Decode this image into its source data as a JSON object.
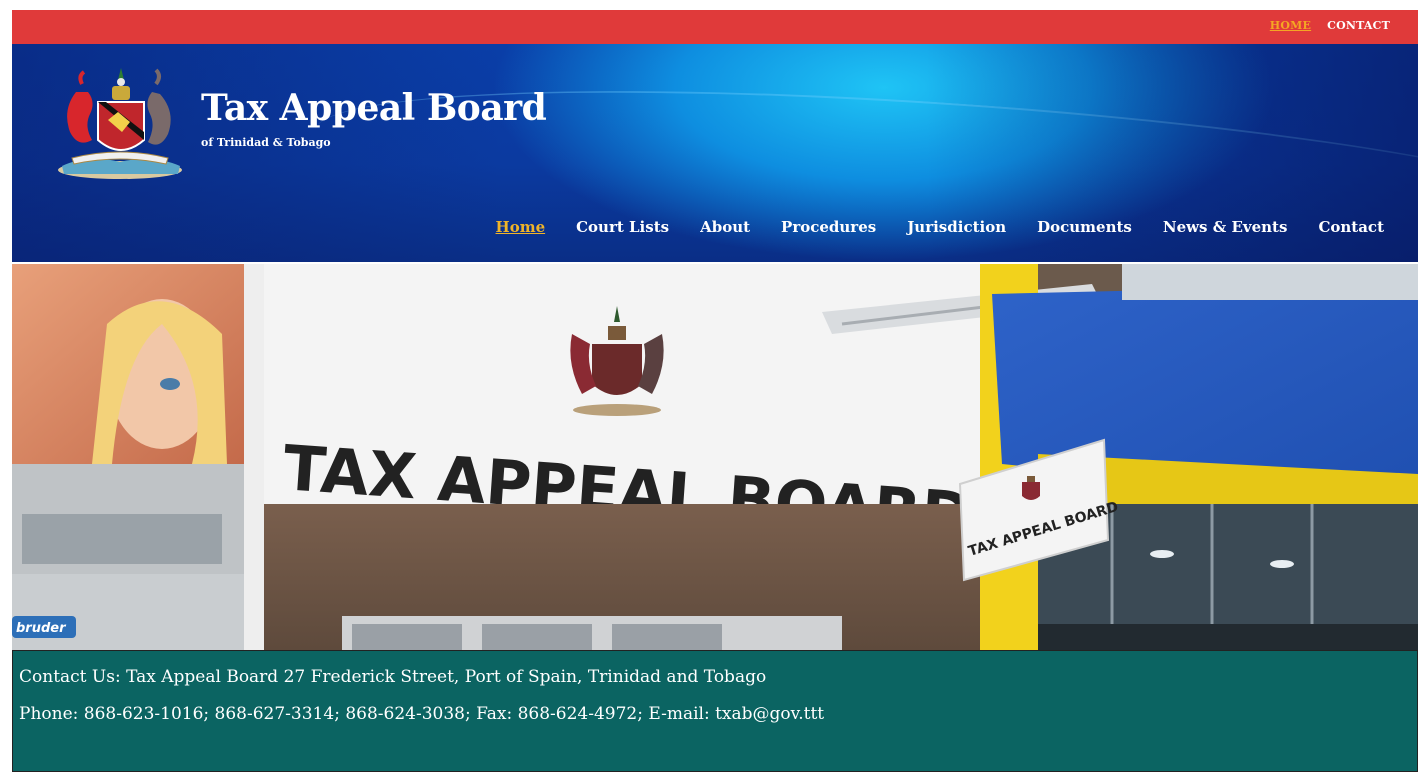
{
  "utility_links": [
    {
      "label": "HOME",
      "active": true
    },
    {
      "label": "CONTACT",
      "active": false
    }
  ],
  "brand": {
    "title": "Tax Appeal Board",
    "subtitle": "of Trinidad & Tobago",
    "logo_icon": "coat-of-arms-icon"
  },
  "nav": [
    {
      "label": "Home",
      "active": true
    },
    {
      "label": "Court Lists",
      "active": false
    },
    {
      "label": "About",
      "active": false
    },
    {
      "label": "Procedures",
      "active": false
    },
    {
      "label": "Jurisdiction",
      "active": false
    },
    {
      "label": "Documents",
      "active": false
    },
    {
      "label": "News & Events",
      "active": false
    },
    {
      "label": "Contact",
      "active": false
    }
  ],
  "hero": {
    "sign_text": "TAX APPEAL BOARD",
    "small_sign_text": "TAX APPEAL BOARD",
    "store_text": "bruder"
  },
  "contact": {
    "line1": "Contact Us: Tax Appeal Board 27 Frederick Street, Port of Spain, Trinidad and Tobago",
    "line2": "Phone: 868-623-1016; 868-627-3314; 868-624-3038; Fax: 868-624-4972; E-mail: txab@gov.ttt"
  },
  "colors": {
    "topbar": "#e03a3a",
    "header_blue": "#0b3aa0",
    "accent_gold": "#f0b429",
    "contact_band": "#0b6462"
  }
}
